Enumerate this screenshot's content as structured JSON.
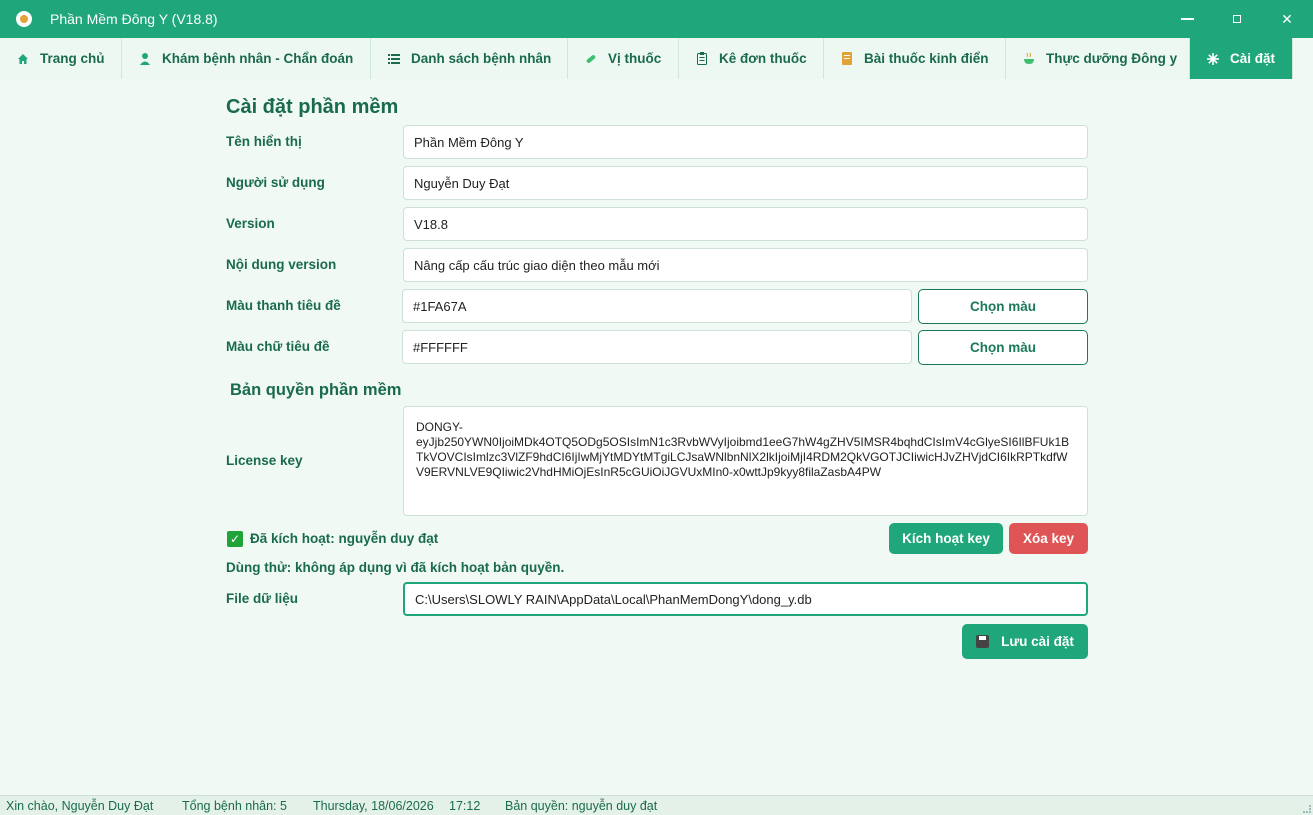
{
  "window": {
    "title": "Phần Mềm Đông Y (V18.8)",
    "minimize_glyph": "—",
    "close_glyph": "✕",
    "accent": "#1FA67A"
  },
  "tabs": [
    {
      "label": "Trang chủ",
      "icon": "home-icon"
    },
    {
      "label": "Khám bệnh nhân - Chẩn đoán",
      "icon": "doctor-icon"
    },
    {
      "label": "Danh sách bệnh nhân",
      "icon": "list-icon"
    },
    {
      "label": "Vị thuốc",
      "icon": "pill-icon"
    },
    {
      "label": "Kê đơn thuốc",
      "icon": "clipboard-icon"
    },
    {
      "label": "Bài thuốc kinh điển",
      "icon": "book-icon"
    },
    {
      "label": "Thực dưỡng Đông y",
      "icon": "bowl-icon"
    },
    {
      "label": "Cài đặt",
      "icon": "gear-icon",
      "active": true
    }
  ],
  "settings": {
    "heading": "Cài đặt phần mềm",
    "display_name_label": "Tên hiển thị",
    "display_name_value": "Phần Mềm Đông Y",
    "user_label": "Người sử dụng",
    "user_value": "Nguyễn Duy Đạt",
    "version_label": "Version",
    "version_value": "V18.8",
    "version_notes_label": "Nội dung version",
    "version_notes_value": "Nâng cấp cấu trúc giao diện theo mẫu mới",
    "title_bar_color_label": "Màu thanh tiêu đề",
    "title_bar_color_value": "#1FA67A",
    "title_text_color_label": "Màu chữ tiêu đề",
    "title_text_color_value": "#FFFFFF",
    "pick_color_label": "Chọn màu"
  },
  "license": {
    "section_title": "Bản quyền phần mềm",
    "key_label": "License key",
    "key_value": "DONGY-\neyJjb250YWN0IjoiMDk4OTQ5ODg5OSIsImN1c3RvbWVyIjoibmd1eeG7hW4gZHV5IMSR4bqhdCIsImV4cGlyeSI6IlBFUk1BTkVOVCIsImlzc3VlZF9hdCI6IjIwMjYtMDYtMTgiLCJsaWNlbnNlX2lkIjoiMjI4RDM2QkVGOTJCIiwicHJvZHVjdCI6IkRPTkdfWV9ERVNLVE9QIiwic2VhdHMiOjEsInR5cGUiOiJGVUxMIn0-x0wttJp9kyy8filaZasbA4PW",
    "activated_text": "Đã kích hoạt: nguyễn duy đạt",
    "trial_text": "Dùng thử: không áp dụng vì đã kích hoạt bản quyền.",
    "activate_button": "Kích hoạt key",
    "delete_button": "Xóa key"
  },
  "data_file": {
    "label": "File dữ liệu",
    "path": "C:\\Users\\SLOWLY RAIN\\AppData\\Local\\PhanMemDongY\\dong_y.db"
  },
  "save_button": "Lưu cài đặt",
  "status": {
    "greeting": "Xin chào, Nguyễn Duy Đạt",
    "patients": "Tổng bệnh nhân: 5",
    "date": "Thursday, 18/06/2026",
    "time": "17:12",
    "license": "Bản quyền: nguyễn duy đạt"
  }
}
